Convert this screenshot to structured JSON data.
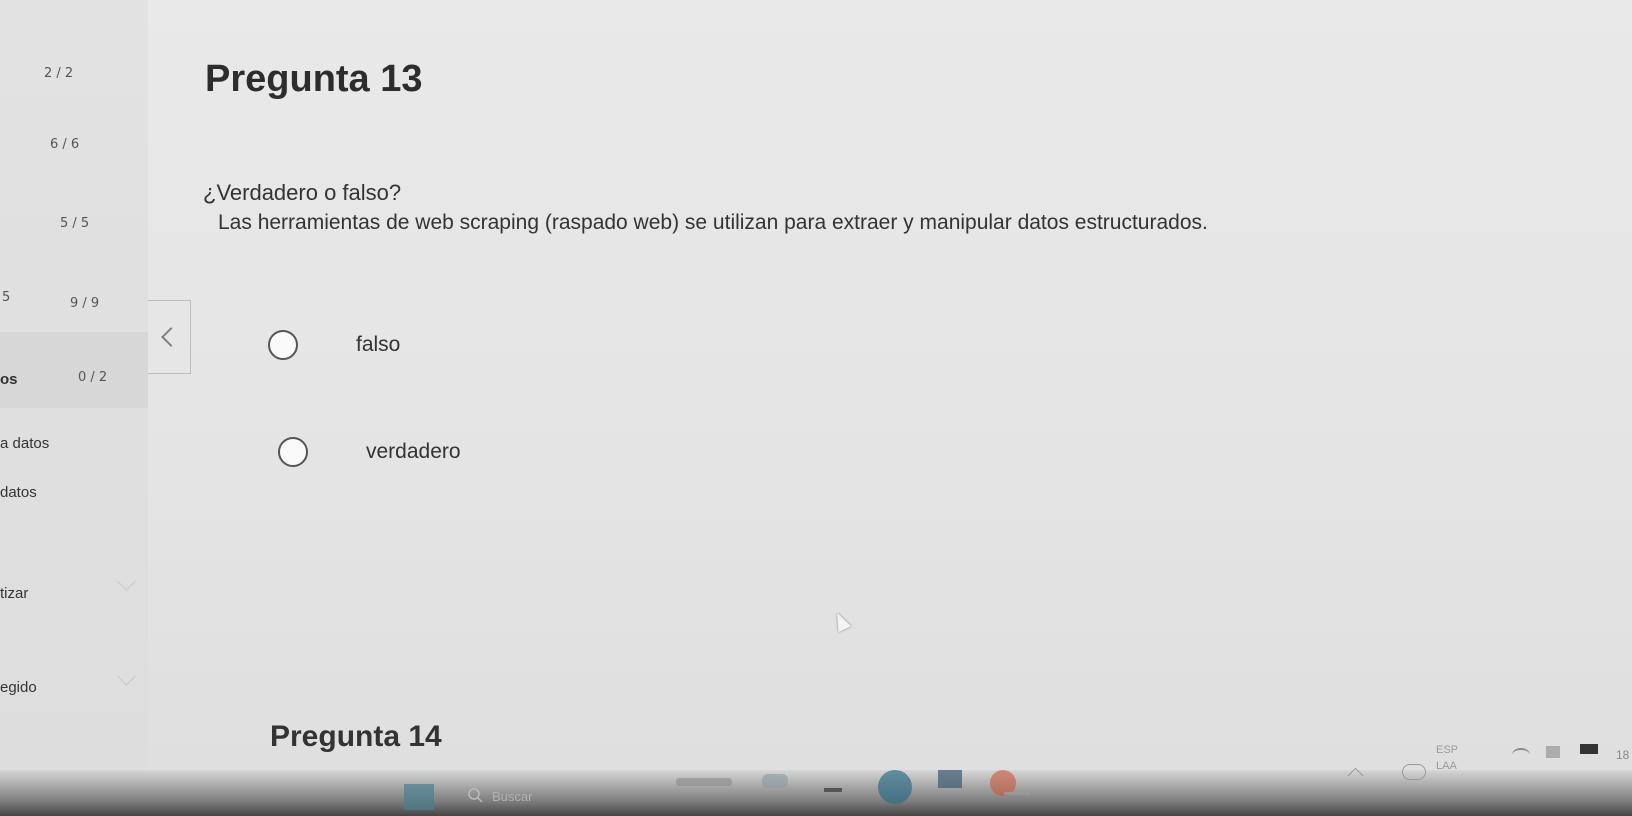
{
  "sidebar": {
    "scores": [
      "2 / 2",
      "6 / 6",
      "5 / 5",
      "9 / 9",
      "0 / 2"
    ],
    "labels": [
      "os",
      "a datos",
      "datos",
      "tizar",
      "egido"
    ],
    "stray_char": "5"
  },
  "question": {
    "title": "Pregunta 13",
    "type": "¿Verdadero o falso?",
    "text": "Las herramientas de web scraping (raspado web) se utilizan para extraer y manipular datos estructurados.",
    "options": [
      "falso",
      "verdadero"
    ]
  },
  "next_question": {
    "title": "Pregunta 14"
  },
  "taskbar": {
    "search_placeholder": "Buscar",
    "lang_top": "ESP",
    "lang_bottom": "LAA",
    "clock_partial": "18"
  }
}
